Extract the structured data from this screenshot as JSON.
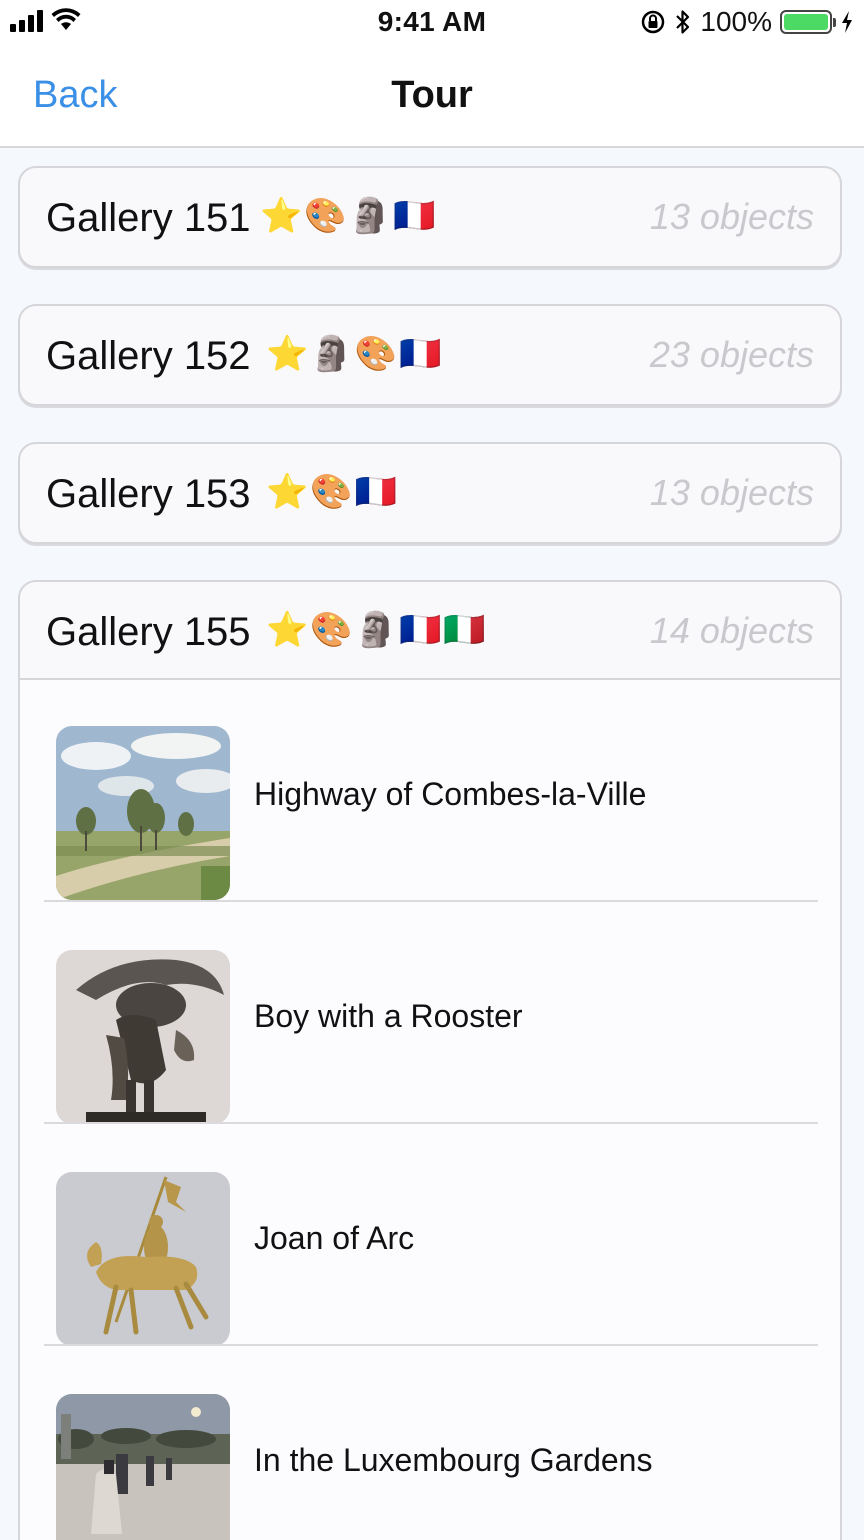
{
  "status_bar": {
    "time": "9:41 AM",
    "battery_percent": "100%",
    "battery_level": 1.0,
    "icons": [
      "signal-icon",
      "wifi-icon",
      "orientation-lock-icon",
      "bluetooth-icon",
      "battery-icon",
      "charging-icon"
    ]
  },
  "nav": {
    "back_label": "Back",
    "title": "Tour"
  },
  "galleries": [
    {
      "name": "Gallery 151",
      "emojis": "⭐🎨🗿🇫🇷",
      "count": "13 objects"
    },
    {
      "name": "Gallery 152",
      "emojis": "⭐🗿🎨🇫🇷",
      "count": "23 objects"
    },
    {
      "name": "Gallery 153",
      "emojis": "⭐🎨🇫🇷",
      "count": "13 objects"
    },
    {
      "name": "Gallery 155",
      "emojis": "⭐🎨🗿🇫🇷🇮🇹",
      "count": "14 objects"
    }
  ],
  "objects": [
    {
      "title": "Highway of Combes-la-Ville"
    },
    {
      "title": "Boy with a Rooster"
    },
    {
      "title": "Joan of Arc"
    },
    {
      "title": "In the Luxembourg Gardens"
    }
  ],
  "colors": {
    "accent": "#3a8fe6",
    "battery": "#4cd964",
    "count_text": "#c9c9cd"
  }
}
